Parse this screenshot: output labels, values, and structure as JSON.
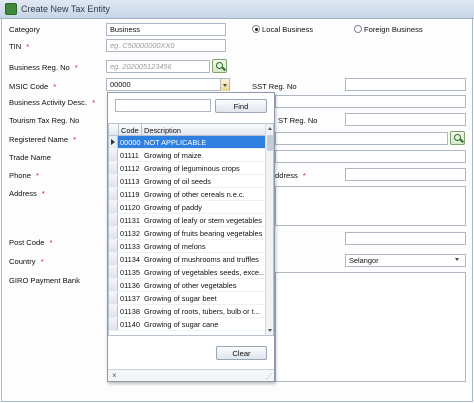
{
  "window": {
    "title": "Create New Tax Entity"
  },
  "form": {
    "category": {
      "label": "Category",
      "value": "Business"
    },
    "entity_type": {
      "local_label": "Local Business",
      "foreign_label": "Foreign Business",
      "selected": "local"
    },
    "tin": {
      "label": "TIN",
      "required": "*",
      "placeholder": "eg. C50000000XX0"
    },
    "business_reg": {
      "label": "Business Reg. No",
      "required": "*",
      "placeholder": "eg. 202005123456"
    },
    "msic": {
      "label": "MSIC Code",
      "required": "*",
      "value": "00000"
    },
    "sst": {
      "label": "SST Reg. No"
    },
    "activity": {
      "label": "Business Activity Desc.",
      "required": "*"
    },
    "tourism": {
      "label": "Tourism Tax Reg. No",
      "sst_partial": "ST Reg. No"
    },
    "registered_name": {
      "label": "Registered Name",
      "required": "*"
    },
    "trade_name": {
      "label": "Trade Name"
    },
    "phone": {
      "label": "Phone",
      "required": "*",
      "address_partial": "ddress",
      "address_req": "*"
    },
    "address": {
      "label": "Address",
      "required": "*"
    },
    "post_code": {
      "label": "Post Code",
      "required": "*"
    },
    "country": {
      "label": "Country",
      "required": "*"
    },
    "state": {
      "value": "Selangor"
    },
    "giro": {
      "label": "GIRO Payment Bank"
    }
  },
  "msic_popup": {
    "search_value": "",
    "find_label": "Find",
    "clear_label": "Clear",
    "col_code": "Code",
    "col_desc": "Description",
    "close_glyph": "×",
    "grip_glyph": "⋰",
    "rows": [
      {
        "code": "00000",
        "desc": "NOT APPLICABLE",
        "selected": true
      },
      {
        "code": "01111",
        "desc": "Growing of maize"
      },
      {
        "code": "01112",
        "desc": "Growing of leguminous crops"
      },
      {
        "code": "01113",
        "desc": "Growing of oil seeds"
      },
      {
        "code": "01119",
        "desc": "Growing of other cereals n.e.c."
      },
      {
        "code": "01120",
        "desc": "Growing of paddy"
      },
      {
        "code": "01131",
        "desc": "Growing of leafy or stem vegetables"
      },
      {
        "code": "01132",
        "desc": "Growing of fruits bearing vegetables"
      },
      {
        "code": "01133",
        "desc": "Growing of melons"
      },
      {
        "code": "01134",
        "desc": "Growing of mushrooms and truffles"
      },
      {
        "code": "01135",
        "desc": "Growing of vegetables seeds, exce..."
      },
      {
        "code": "01136",
        "desc": "Growing of other vegetables"
      },
      {
        "code": "01137",
        "desc": "Growing of sugar beet"
      },
      {
        "code": "01138",
        "desc": "Growing of roots, tubers, bulb or t..."
      },
      {
        "code": "01140",
        "desc": "Growing of sugar cane"
      }
    ]
  },
  "colors": {
    "selection": "#2f7fe0",
    "required": "#d01010",
    "accent_green": "#2f6b25"
  },
  "icons": [
    "app-icon",
    "search-icon",
    "dropdown-arrow-icon",
    "row-pointer-icon",
    "close-icon",
    "resize-grip-icon"
  ]
}
